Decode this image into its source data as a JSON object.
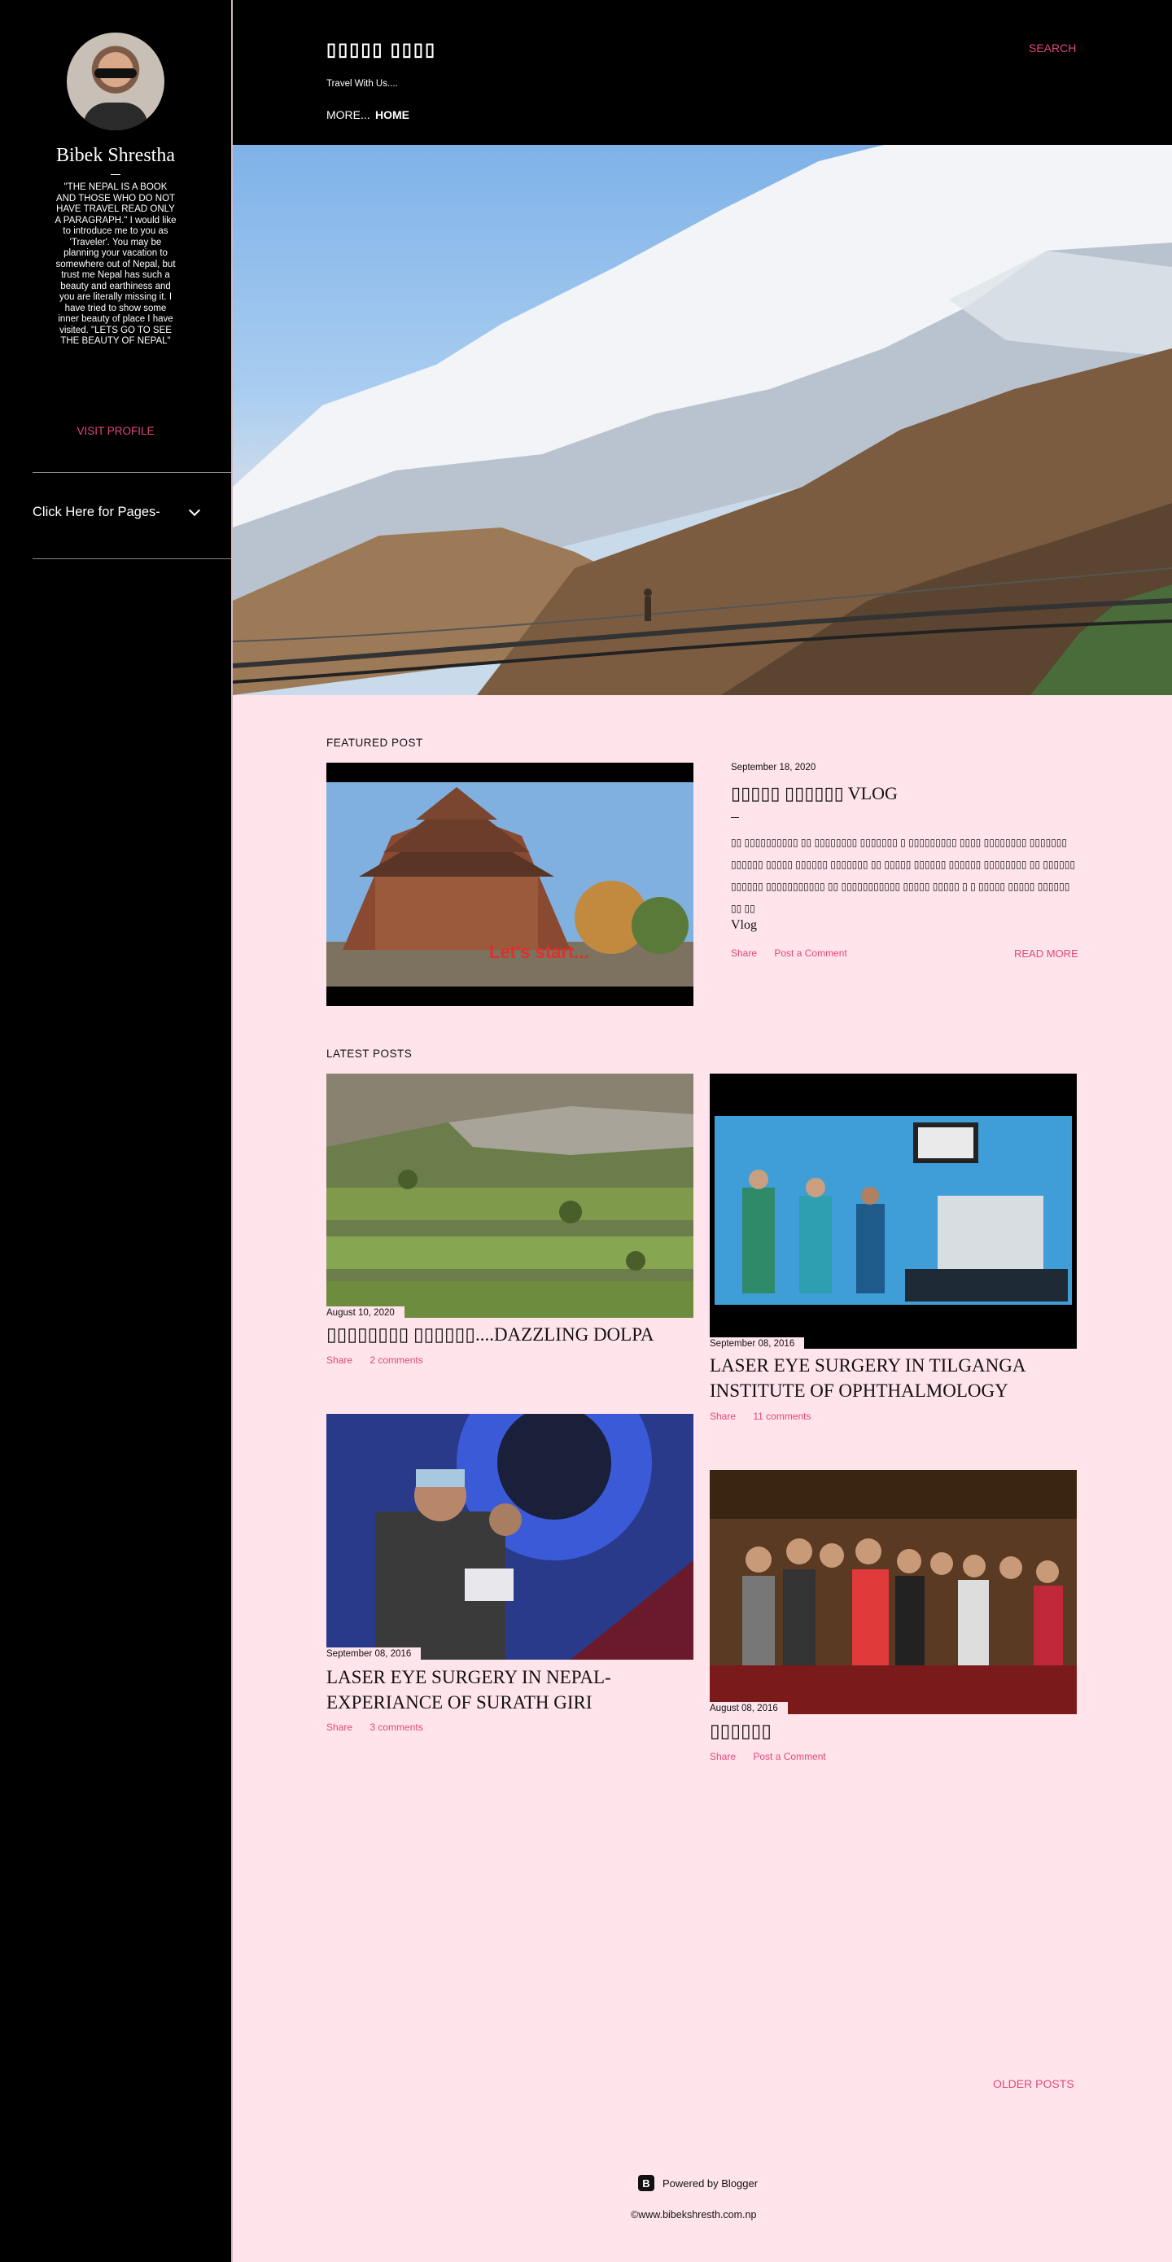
{
  "sidebar": {
    "profile_name": "Bibek Shrestha",
    "bio": "\"THE NEPAL IS A BOOK AND THOSE WHO DO NOT HAVE TRAVEL READ ONLY A PARAGRAPH.\" I would like to introduce me to you as 'Traveler'. You may be planning your vacation to somewhere out of Nepal, but trust me Nepal has such a beauty and earthiness and you are literally missing it. I have tried to show some inner beauty of place I have visited. \"LETS GO TO SEE THE BEAUTY OF NEPAL\"",
    "visit_profile": "VISIT PROFILE",
    "pages_menu": "Click Here for Pages-"
  },
  "header": {
    "title": "▯▯▯▯▯ ▯▯▯▯",
    "description": "Travel With Us....",
    "nav_more": "MORE...",
    "nav_home": "HOME",
    "search": "SEARCH"
  },
  "featured": {
    "section_title": "FEATURED POST",
    "date": "September 18, 2020",
    "title": "▯▯▯▯▯ ▯▯▯▯▯▯ VLOG",
    "snippet": "▯▯ ▯▯▯▯▯▯▯▯▯▯ ▯▯ ▯▯▯▯▯▯▯▯ ▯▯▯▯▯▯▯ ▯ ▯▯▯▯▯▯▯▯▯ ▯▯▯▯ ▯▯▯▯▯▯▯▯ ▯▯▯▯▯▯▯ ▯▯▯▯▯▯ ▯▯▯▯▯ ▯▯▯▯▯▯ ▯▯▯▯▯▯▯ ▯▯ ▯▯▯▯▯ ▯▯▯▯▯▯ ▯▯▯▯▯▯ ▯▯▯▯▯▯▯▯ ▯▯ ▯▯▯▯▯▯ ▯▯▯▯▯▯ ▯▯▯▯▯▯▯▯▯▯▯ ▯▯ ▯▯▯▯▯▯▯▯▯▯▯ ▯▯▯▯▯ ▯▯▯▯▯ ▯ ▯ ▯▯▯▯▯ ▯▯▯▯▯ ▯▯▯▯▯▯ ▯▯ ▯▯",
    "vlog": "Vlog",
    "share": "Share",
    "comment": "Post a Comment",
    "read_more": "READ MORE",
    "image_caption": "Let's start..."
  },
  "latest": {
    "section_title": "LATEST POSTS",
    "posts": [
      {
        "date": "August 10, 2020",
        "title": "▯▯▯▯▯▯▯▯ ▯▯▯▯▯▯....DAZZLING DOLPA",
        "share": "Share",
        "comments": "2 comments"
      },
      {
        "date": "September 08, 2016",
        "title": "LASER EYE SURGERY IN TILGANGA INSTITUTE OF OPHTHALMOLOGY",
        "share": "Share",
        "comments": "11 comments"
      },
      {
        "date": "September 08, 2016",
        "title": "LASER EYE SURGERY IN NEPAL-EXPERIANCE OF SURATH GIRI",
        "share": "Share",
        "comments": "3 comments"
      },
      {
        "date": "August 08, 2016",
        "title": "▯▯▯▯▯▯",
        "share": "Share",
        "comments": "Post a Comment"
      }
    ]
  },
  "footer": {
    "older_posts": "OLDER POSTS",
    "powered_by": "Powered by Blogger",
    "copyright": "©www.bibekshresth.com.np"
  },
  "colors": {
    "accent": "#e4477a",
    "background": "#ffe4ec",
    "sidebar": "#000000"
  }
}
